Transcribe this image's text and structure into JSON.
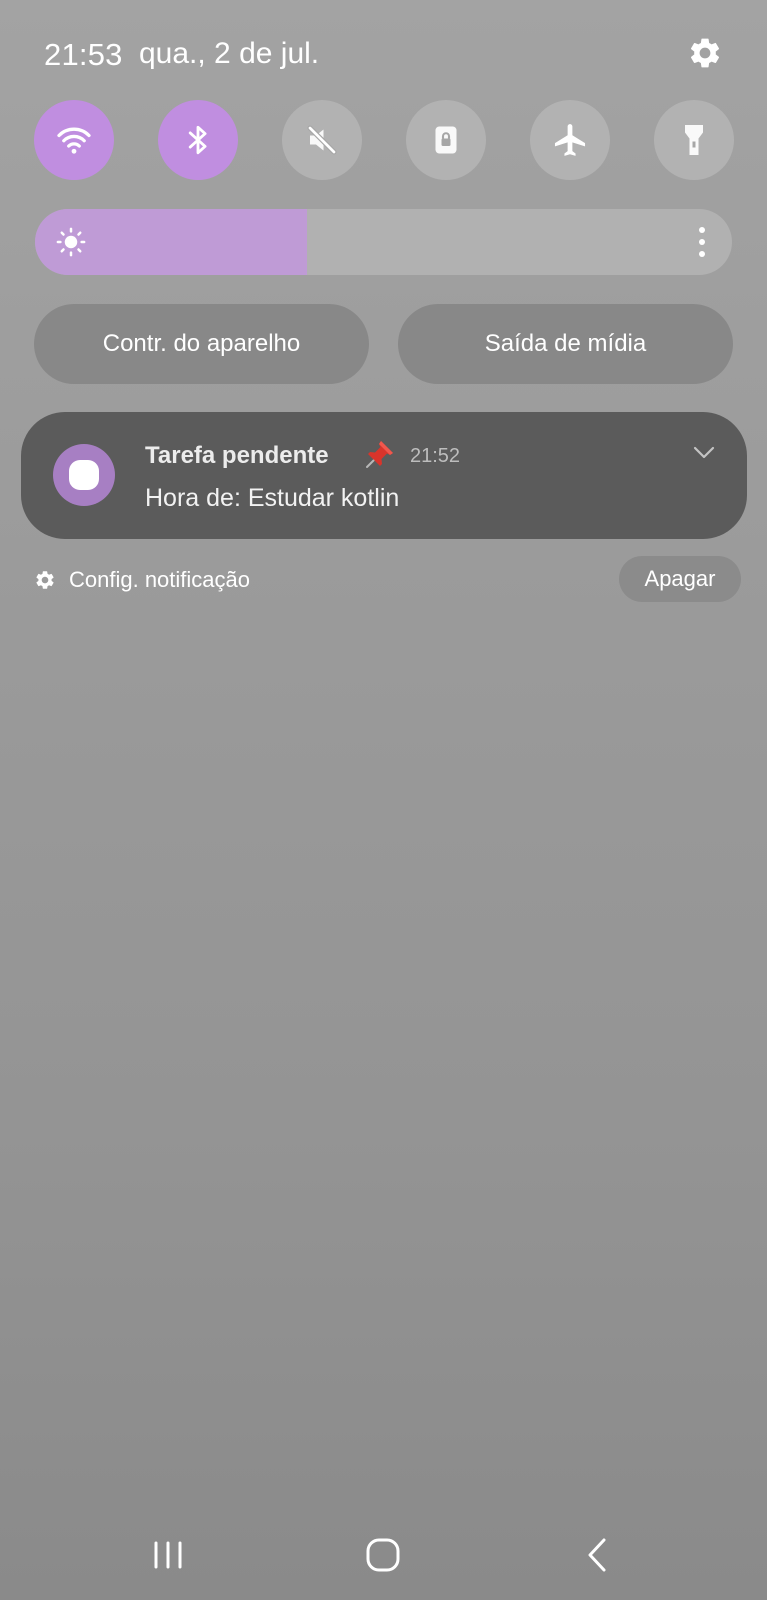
{
  "status_bar": {
    "time": "21:53",
    "date": "qua., 2 de jul."
  },
  "quick_settings": {
    "tiles": [
      {
        "icon": "wifi-icon",
        "state": "on"
      },
      {
        "icon": "bluetooth-icon",
        "state": "on"
      },
      {
        "icon": "sound-off-icon",
        "state": "off"
      },
      {
        "icon": "lock-icon",
        "state": "off"
      },
      {
        "icon": "airplane-icon",
        "state": "off"
      },
      {
        "icon": "flashlight-icon",
        "state": "off"
      }
    ],
    "brightness": {
      "level_percent": 39
    },
    "device_control_label": "Contr. do aparelho",
    "media_output_label": "Saída de mídia"
  },
  "notification": {
    "title": "Tarefa pendente",
    "time": "21:52",
    "body": "Hora de: Estudar kotlin",
    "app_icon_color": "#a77fc3"
  },
  "notification_footer": {
    "settings_label": "Config. notificação",
    "clear_label": "Apagar"
  },
  "colors": {
    "accent": "#c08ee0",
    "brightness_fill": "#bf9bd6",
    "card": "#5b5b5b"
  }
}
